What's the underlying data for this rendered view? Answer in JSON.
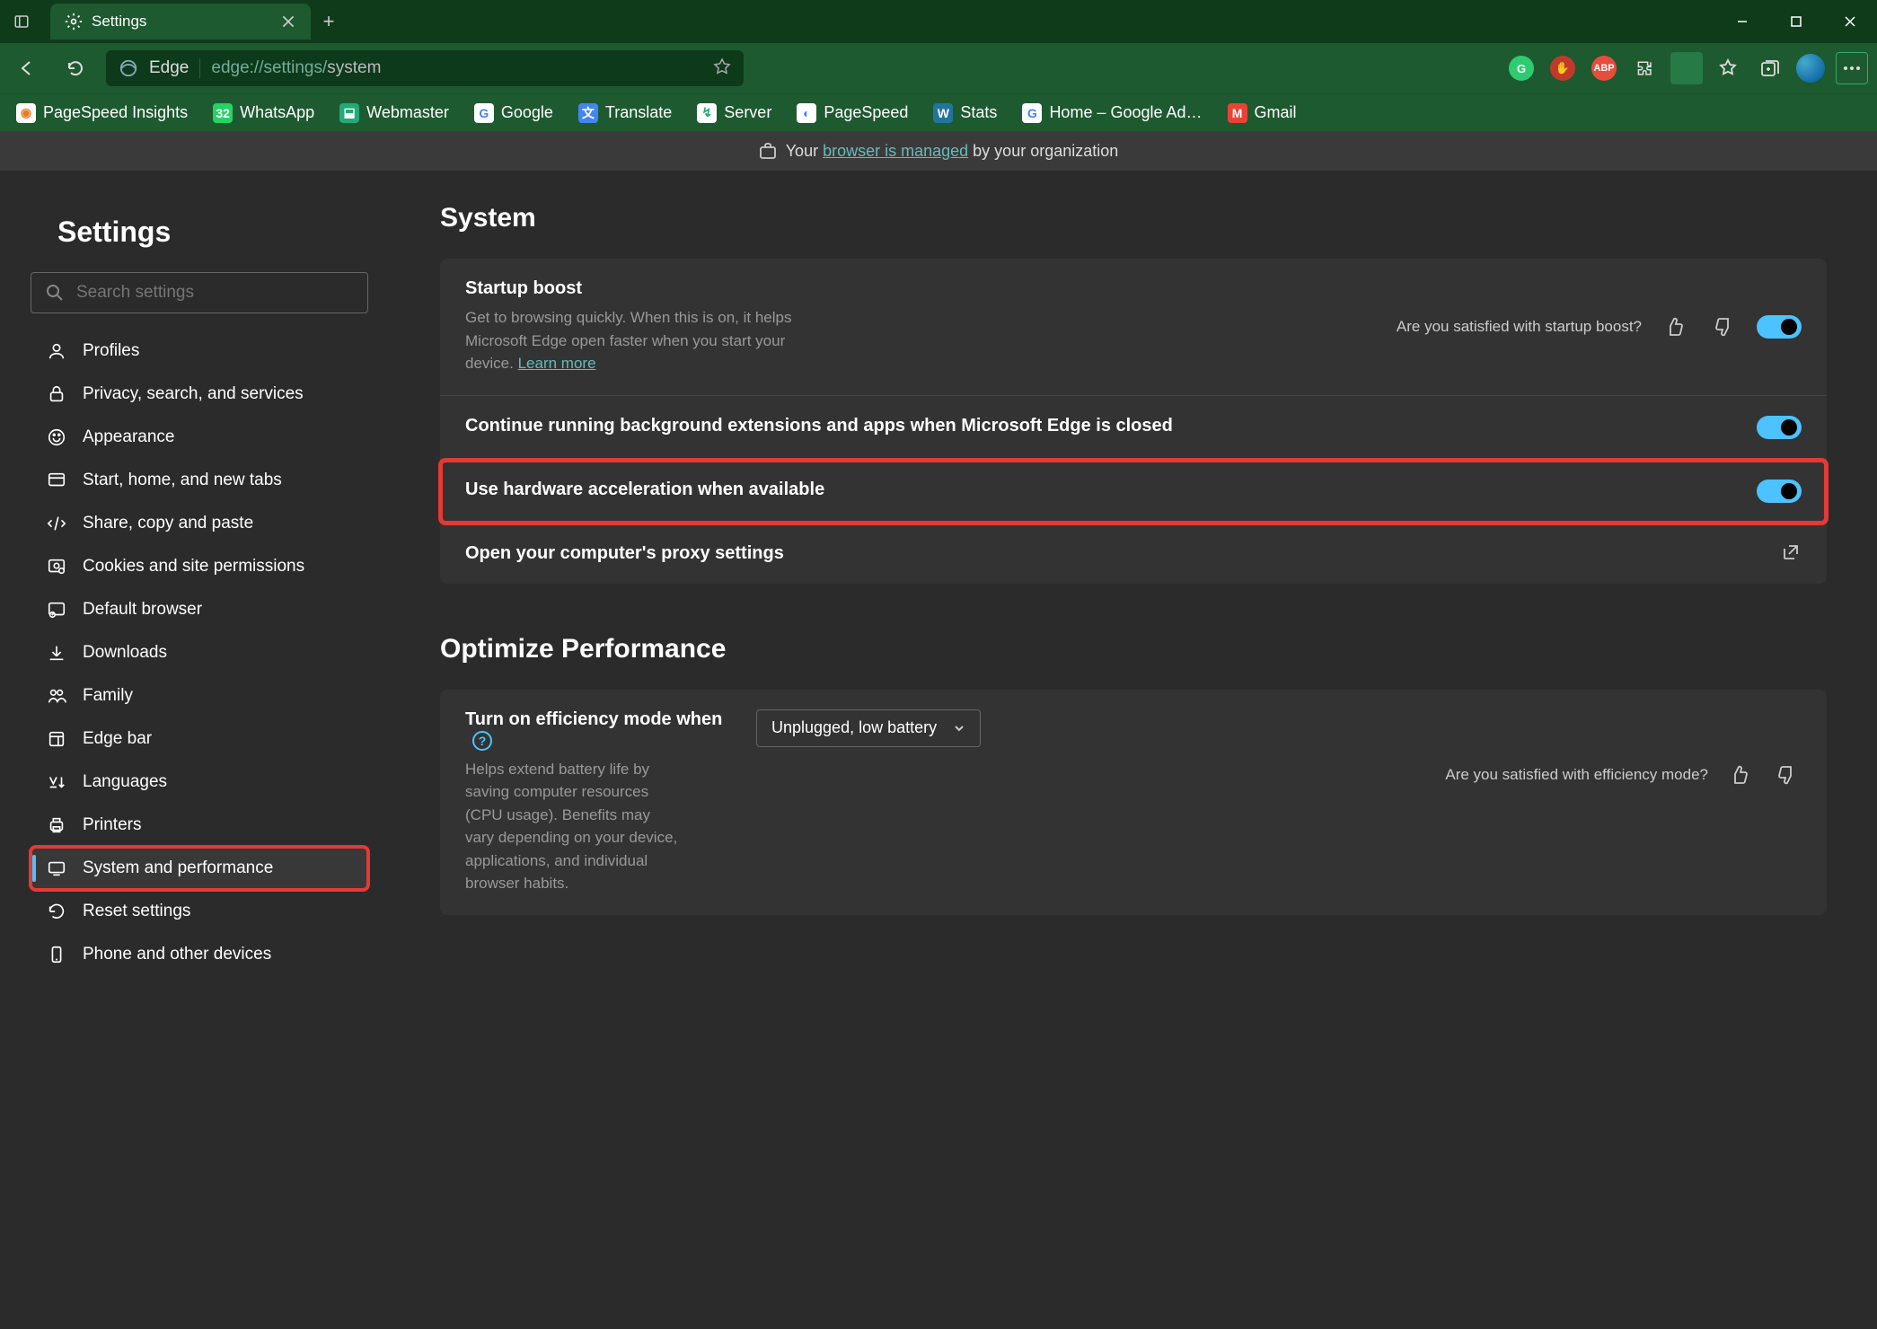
{
  "window": {
    "tab_label": "Settings"
  },
  "address": {
    "browser": "Edge",
    "url_prefix": "edge://settings/",
    "url_path": "system"
  },
  "bookmarks": [
    "PageSpeed Insights",
    "WhatsApp",
    "Webmaster",
    "Google",
    "Translate",
    "Server",
    "PageSpeed",
    "Stats",
    "Home – Google Ad…",
    "Gmail"
  ],
  "managed": {
    "prefix": "Your ",
    "link": "browser is managed",
    "suffix": " by your organization"
  },
  "sidebar": {
    "title": "Settings",
    "search_placeholder": "Search settings",
    "items": [
      "Profiles",
      "Privacy, search, and services",
      "Appearance",
      "Start, home, and new tabs",
      "Share, copy and paste",
      "Cookies and site permissions",
      "Default browser",
      "Downloads",
      "Family",
      "Edge bar",
      "Languages",
      "Printers",
      "System and performance",
      "Reset settings",
      "Phone and other devices"
    ],
    "active_index": 12
  },
  "main": {
    "section1_title": "System",
    "startup": {
      "title": "Startup boost",
      "desc": "Get to browsing quickly. When this is on, it helps Microsoft Edge open faster when you start your device. ",
      "learn": "Learn more",
      "feedback": "Are you satisfied with startup boost?"
    },
    "bg": {
      "title": "Continue running background extensions and apps when Microsoft Edge is closed"
    },
    "hw": {
      "title": "Use hardware acceleration when available"
    },
    "proxy": {
      "title": "Open your computer's proxy settings"
    },
    "section2_title": "Optimize Performance",
    "efficiency": {
      "title": "Turn on efficiency mode when",
      "desc": "Helps extend battery life by saving computer resources (CPU usage). Benefits may vary depending on your device, applications, and individual browser habits.",
      "selected": "Unplugged, low battery",
      "feedback": "Are you satisfied with efficiency mode?"
    }
  }
}
